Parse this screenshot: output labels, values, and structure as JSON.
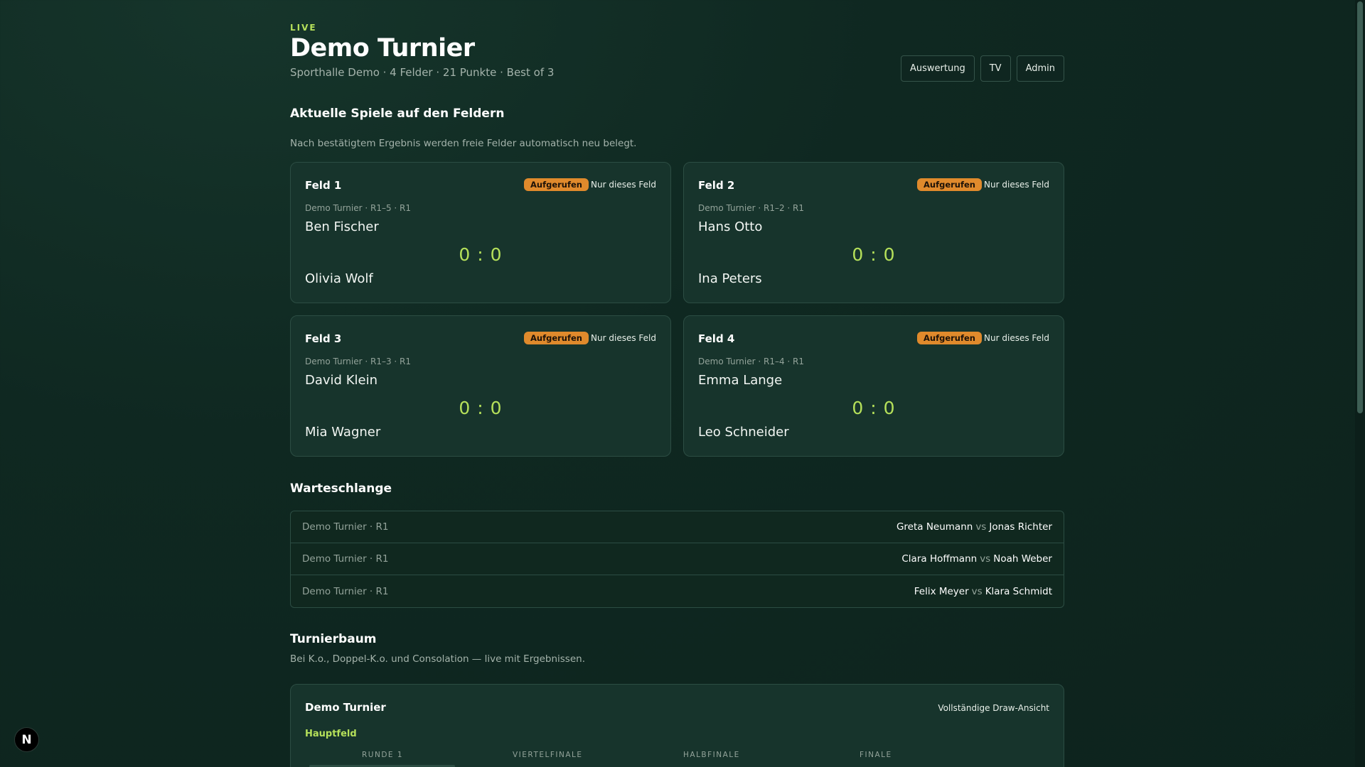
{
  "header": {
    "live_label": "LIVE",
    "title": "Demo Turnier",
    "subtitle": "Sporthalle Demo · 4 Felder · 21 Punkte · Best of 3",
    "actions": [
      "Auswertung",
      "TV",
      "Admin"
    ]
  },
  "current": {
    "title": "Aktuelle Spiele auf den Feldern",
    "subtitle": "Nach bestätigtem Ergebnis werden freie Felder automatisch neu belegt.",
    "fields": [
      {
        "name": "Feld 1",
        "status": "Aufgerufen",
        "only_label": "Nur dieses Feld",
        "meta": "Demo Turnier · R1–5 · R1",
        "player_a": "Ben Fischer",
        "player_b": "Olivia Wolf",
        "score": "0 : 0"
      },
      {
        "name": "Feld 2",
        "status": "Aufgerufen",
        "only_label": "Nur dieses Feld",
        "meta": "Demo Turnier · R1–2 · R1",
        "player_a": "Hans Otto",
        "player_b": "Ina Peters",
        "score": "0 : 0"
      },
      {
        "name": "Feld 3",
        "status": "Aufgerufen",
        "only_label": "Nur dieses Feld",
        "meta": "Demo Turnier · R1–3 · R1",
        "player_a": "David Klein",
        "player_b": "Mia Wagner",
        "score": "0 : 0"
      },
      {
        "name": "Feld 4",
        "status": "Aufgerufen",
        "only_label": "Nur dieses Feld",
        "meta": "Demo Turnier · R1–4 · R1",
        "player_a": "Emma Lange",
        "player_b": "Leo Schneider",
        "score": "0 : 0"
      }
    ]
  },
  "queue": {
    "title": "Warteschlange",
    "vs_label": "vs",
    "rows": [
      {
        "meta": "Demo Turnier · R1",
        "player_a": "Greta Neumann",
        "player_b": "Jonas Richter"
      },
      {
        "meta": "Demo Turnier · R1",
        "player_a": "Clara Hoffmann",
        "player_b": "Noah Weber"
      },
      {
        "meta": "Demo Turnier · R1",
        "player_a": "Felix Meyer",
        "player_b": "Klara Schmidt"
      }
    ]
  },
  "bracket": {
    "title": "Turnierbaum",
    "subtitle": "Bei K.o., Doppel-K.o. und Consolation — live mit Ergebnissen.",
    "card_title": "Demo Turnier",
    "full_view_link": "Vollständige Draw-Ansicht",
    "section": "Hauptfeld",
    "rounds": [
      "RUNDE 1",
      "VIERTELFINALE",
      "HALBFINALE",
      "FINALE"
    ]
  },
  "badge": {
    "letter": "N"
  },
  "colors": {
    "accent": "#b5e05a",
    "status": "#e08a2c",
    "background": "#0f2821"
  }
}
